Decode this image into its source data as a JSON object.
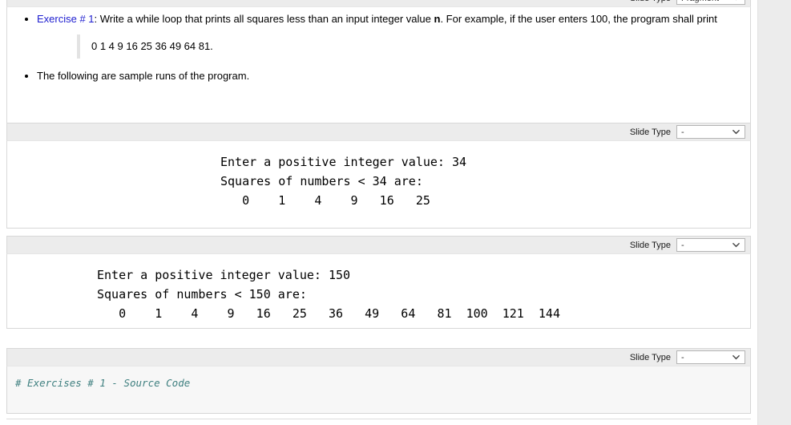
{
  "app": {
    "slide_type_label": "Slide Type",
    "chevron_icon": "chevron-down-icon"
  },
  "cells": [
    {
      "kind": "markdown",
      "slide_type": "Fragment",
      "bullets": [
        {
          "link_text": "Exercise # 1",
          "text_before_bold": ": Write a while loop that prints all squares less than an input integer value ",
          "bold_text": "n",
          "text_after_bold": ". For example, if the user enters 100, the program shall print"
        },
        {
          "text": "The following are sample runs of the program."
        }
      ],
      "quote": "0 1 4 9 16 25 36 49 64 81."
    },
    {
      "kind": "output",
      "slide_type": "-",
      "lines": [
        "Enter a positive integer value: 34",
        "Squares of numbers < 34 are:",
        "   0    1    4    9   16   25"
      ]
    },
    {
      "kind": "output",
      "slide_type": "-",
      "lines": [
        "Enter a positive integer value: 150",
        "Squares of numbers < 150 are:",
        "   0    1    4    9   16   25   36   49   64   81  100  121  144"
      ]
    },
    {
      "kind": "code",
      "slide_type": "-",
      "source": "# Exercises # 1 - Source Code"
    }
  ],
  "program_output": {
    "run_1": {
      "prompt": "Enter a positive integer value: 34",
      "input_value": 34,
      "heading": "Squares of numbers < 34 are:",
      "squares": [
        0,
        1,
        4,
        9,
        16,
        25
      ]
    },
    "run_2": {
      "prompt": "Enter a positive integer value: 150",
      "input_value": 150,
      "heading": "Squares of numbers < 150 are:",
      "squares": [
        0,
        1,
        4,
        9,
        16,
        25,
        36,
        49,
        64,
        81,
        100,
        121,
        144
      ]
    },
    "expected_sample": [
      0,
      1,
      4,
      9,
      16,
      25,
      36,
      49,
      64,
      81
    ]
  },
  "colors": {
    "link": "#2020d0",
    "comment": "#408080",
    "cell_header": "#ececec",
    "code_background": "#f7f7f7"
  }
}
